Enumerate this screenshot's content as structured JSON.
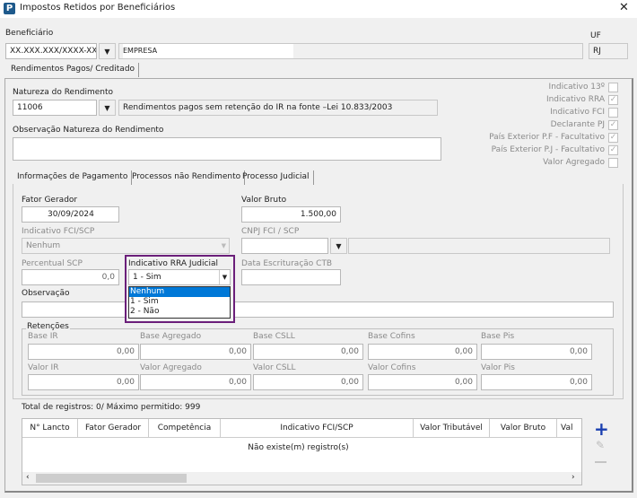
{
  "window": {
    "title": "Impostos Retidos por Beneficiários",
    "close_icon": "close-icon",
    "app_icon": "P"
  },
  "beneficiario": {
    "label": "Beneficiário",
    "cnpj": "XX.XXX.XXX/XXXX-XX",
    "nome": "EMPRESA",
    "uf_label": "UF",
    "uf": "RJ"
  },
  "main_tab": "Rendimentos Pagos/ Creditado",
  "natureza": {
    "label": "Natureza do Rendimento",
    "code": "11006",
    "description": "Rendimentos pagos sem retenção do IR na fonte –Lei 10.833/2003",
    "obs_label": "Observação Natureza do Rendimento",
    "obs_value": ""
  },
  "checkboxes": [
    {
      "label": "Indicativo 13º",
      "checked": false
    },
    {
      "label": "Indicativo RRA",
      "checked": true
    },
    {
      "label": "Indicativo FCI",
      "checked": false
    },
    {
      "label": "Declarante PJ",
      "checked": true
    },
    {
      "label": "País Exterior P.F - Facultativo",
      "checked": true
    },
    {
      "label": "País Exterior P.J - Facultativo",
      "checked": true
    },
    {
      "label": "Valor Agregado",
      "checked": false
    }
  ],
  "sub_tabs": [
    "Informações de Pagamento",
    "Processos não Rendimento",
    "Processo Judicial"
  ],
  "pagamento": {
    "fator_gerador_label": "Fator Gerador",
    "fator_gerador": "30/09/2024",
    "valor_bruto_label": "Valor Bruto",
    "valor_bruto": "1.500,00",
    "fci_label": "Indicativo FCI/SCP",
    "fci_value": "Nenhum",
    "cnpj_fci_label": "CNPJ FCI / SCP",
    "percentual_label": "Percentual SCP",
    "percentual": "0,0",
    "rra_label": "Indicativo RRA Judicial",
    "rra_value": "1 - Sim",
    "rra_options": [
      "Nenhum",
      "1 - Sim",
      "2 - Não"
    ],
    "rra_highlighted": "Nenhum",
    "data_ctb_label": "Data Escrituração CTB",
    "obs_label": "Observação"
  },
  "retencoes": {
    "label": "Retenções",
    "base": [
      {
        "label": "Base IR",
        "value": "0,00"
      },
      {
        "label": "Base Agregado",
        "value": "0,00"
      },
      {
        "label": "Base CSLL",
        "value": "0,00"
      },
      {
        "label": "Base Cofins",
        "value": "0,00"
      },
      {
        "label": "Base Pis",
        "value": "0,00"
      }
    ],
    "valor": [
      {
        "label": "Valor IR",
        "value": "0,00"
      },
      {
        "label": "Valor Agregado",
        "value": "0,00"
      },
      {
        "label": "Valor CSLL",
        "value": "0,00"
      },
      {
        "label": "Valor Cofins",
        "value": "0,00"
      },
      {
        "label": "Valor Pis",
        "value": "0,00"
      }
    ]
  },
  "table": {
    "total": "Total de registros: 0/ Máximo permitido: 999",
    "columns": [
      "N° Lancto",
      "Fator Gerador",
      "Competência",
      "Indicativo FCI/SCP",
      "Valor Tributável",
      "Valor Bruto",
      "Val"
    ],
    "empty": "Não existe(m) registro(s)"
  },
  "colors": {
    "highlight_border": "#6b1f7a",
    "selection": "#0078d7",
    "add_icon": "#1a3fb0"
  }
}
